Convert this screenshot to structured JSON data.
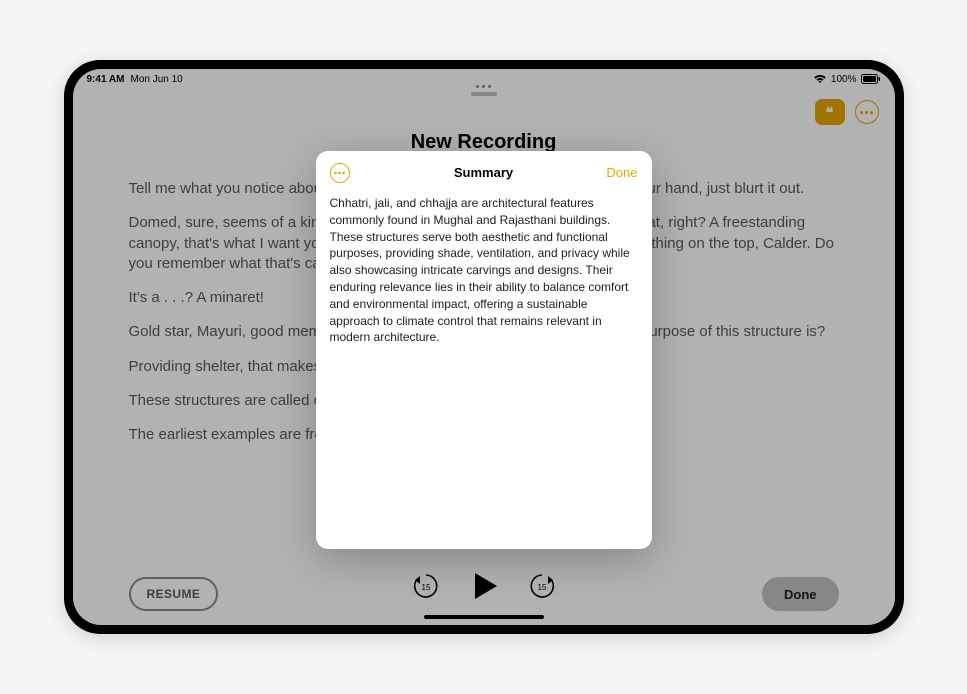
{
  "statusbar": {
    "time": "9:41 AM",
    "date": "Mon Jun 10",
    "battery_pct": "100%"
  },
  "toolbar": {
    "quote_glyph": "❝",
    "more_label": "more-options"
  },
  "note": {
    "title": "New Recording",
    "paragraphs": [
      "Tell me what you notice about this structure. No, no, you don't have to raise your hand, just blurt it out.",
      "Domed, sure, seems of a kind with some of the architecture that we've looked at, right? A freestanding canopy, that's what I want you to remember: a platform of fine carvings. Pointy thing on the top, Calder. Do you remember what that's called?",
      "It's a . . .? A minaret!",
      "Gold star, Mayuri, good memory. And then—what can we kind of imagine the purpose of this structure is?",
      "Providing shelter, that makes sense, doesn't it? And you're absolutely correct.",
      "These structures are called chhatri.",
      "The earliest examples are from . . . Gujarat, but we"
    ]
  },
  "transport": {
    "resume_label": "RESUME",
    "done_label": "Done",
    "skip_seconds": "15"
  },
  "modal": {
    "title": "Summary",
    "done_label": "Done",
    "body": "Chhatri, jali, and chhajja are architectural features commonly found in Mughal and Rajasthani buildings. These structures serve both aesthetic and functional purposes, providing shade, ventilation, and privacy while also showcasing intricate carvings and designs. Their enduring relevance lies in their ability to balance comfort and environmental impact, offering a sustainable approach to climate control that remains relevant in modern architecture."
  }
}
